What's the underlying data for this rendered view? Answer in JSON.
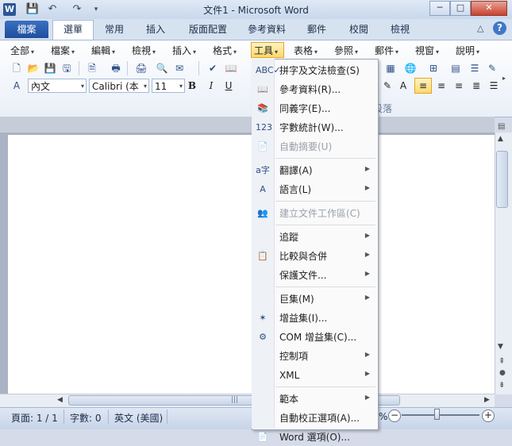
{
  "title_bar": {
    "app_logo": "W",
    "title": "文件1 - Microsoft Word",
    "quick_access": [
      "save-icon",
      "undo-icon",
      "redo-icon",
      "customize-icon"
    ],
    "window_buttons": {
      "minimize": "─",
      "maximize": "□",
      "close": "✕"
    }
  },
  "ribbon_tabs": {
    "file": "檔案",
    "tabs": [
      "選單",
      "常用",
      "插入",
      "版面配置",
      "參考資料",
      "郵件",
      "校閱",
      "檢視"
    ],
    "active": "選單",
    "minimize_icon": "△",
    "help_icon": "?"
  },
  "menu_bar": [
    "全部",
    "檔案",
    "編輯",
    "檢視",
    "插入",
    "格式",
    "工具",
    "表格",
    "參照",
    "郵件",
    "視窗",
    "說明"
  ],
  "active_menu": "工具",
  "format_bar": {
    "style": "內文",
    "font": "Calibri (本",
    "size": "11",
    "bold": "B",
    "italic": "I",
    "underline": "U",
    "group_label": "段落"
  },
  "dropdown": [
    {
      "label": "拼字及文法檢查(S)",
      "icon": "spelling-icon",
      "glyph": "ABC✓",
      "enabled": true,
      "submenu": false
    },
    {
      "label": "參考資料(R)...",
      "icon": "research-icon",
      "glyph": "📖",
      "enabled": true,
      "submenu": false
    },
    {
      "label": "同義字(E)...",
      "icon": "thesaurus-icon",
      "glyph": "📚",
      "enabled": true,
      "submenu": false
    },
    {
      "label": "字數統計(W)...",
      "icon": "word-count-icon",
      "glyph": "123",
      "enabled": true,
      "submenu": false
    },
    {
      "label": "自動摘要(U)",
      "icon": "autosummary-icon",
      "glyph": "📄",
      "enabled": false,
      "submenu": false
    },
    {
      "label": "翻譯(A)",
      "icon": "translate-icon",
      "glyph": "a字",
      "enabled": true,
      "submenu": true,
      "sep_before": true
    },
    {
      "label": "語言(L)",
      "icon": "language-icon",
      "glyph": "A",
      "enabled": true,
      "submenu": true
    },
    {
      "label": "建立文件工作區(C)",
      "icon": "workspace-icon",
      "glyph": "👥",
      "enabled": false,
      "submenu": false,
      "sep_before": true
    },
    {
      "label": "追蹤",
      "icon": "",
      "glyph": "",
      "enabled": true,
      "submenu": true,
      "sep_before": true
    },
    {
      "label": "比較與合併",
      "icon": "compare-icon",
      "glyph": "📋",
      "enabled": true,
      "submenu": true
    },
    {
      "label": "保護文件...",
      "icon": "",
      "glyph": "",
      "enabled": true,
      "submenu": true
    },
    {
      "label": "巨集(M)",
      "icon": "",
      "glyph": "",
      "enabled": true,
      "submenu": true,
      "sep_before": true
    },
    {
      "label": "增益集(I)...",
      "icon": "addins-icon",
      "glyph": "✶",
      "enabled": true,
      "submenu": false
    },
    {
      "label": "COM 增益集(C)...",
      "icon": "com-addins-icon",
      "glyph": "⚙",
      "enabled": true,
      "submenu": false
    },
    {
      "label": "控制項",
      "icon": "",
      "glyph": "",
      "enabled": true,
      "submenu": true
    },
    {
      "label": "XML",
      "icon": "",
      "glyph": "",
      "enabled": true,
      "submenu": true
    },
    {
      "label": "範本",
      "icon": "",
      "glyph": "",
      "enabled": true,
      "submenu": true,
      "sep_before": true
    },
    {
      "label": "自動校正選項(A)...",
      "icon": "",
      "glyph": "",
      "enabled": true,
      "submenu": false
    },
    {
      "label": "Word 選項(O)...",
      "icon": "options-icon",
      "glyph": "📄",
      "enabled": true,
      "submenu": false
    }
  ],
  "status_bar": {
    "page": "頁面: 1 / 1",
    "words": "字數: 0",
    "language": "英文 (美國)",
    "zoom_fraction": 0.45
  },
  "colors": {
    "accent": "#2b5797",
    "file_tab": "#2b5fac",
    "highlight": "#fbd96c"
  }
}
